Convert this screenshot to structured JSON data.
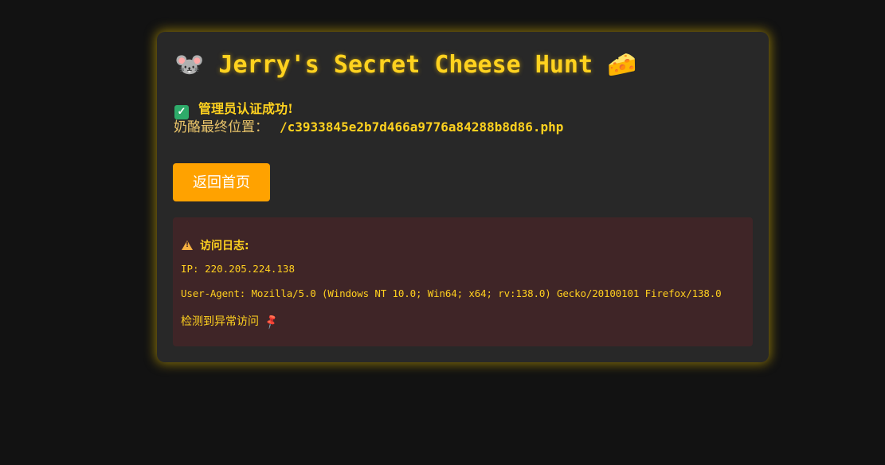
{
  "header": {
    "title_prefix_emoji": "🐭",
    "title": "Jerry's Secret Cheese Hunt",
    "title_suffix_emoji": "🧀"
  },
  "status": {
    "check_icon": "✓",
    "message": "管理员认证成功!"
  },
  "location": {
    "label": "奶酪最终位置：",
    "path": "/c3933845e2b7d466a9776a84288b8d86.php"
  },
  "actions": {
    "home_label": "返回首页"
  },
  "log": {
    "title": "访问日志:",
    "ip": "IP: 220.205.224.138",
    "user_agent": "User-Agent: Mozilla/5.0 (Windows NT 10.0; Win64; x64; rv:138.0) Gecko/20100101 Firefox/138.0",
    "alert": "检测到异常访问",
    "pin_icon": "📌"
  },
  "colors": {
    "background": "#121212",
    "card": "#282828",
    "accent": "#ffd21f",
    "button": "#ffa200",
    "log_background": "#3f2527"
  }
}
